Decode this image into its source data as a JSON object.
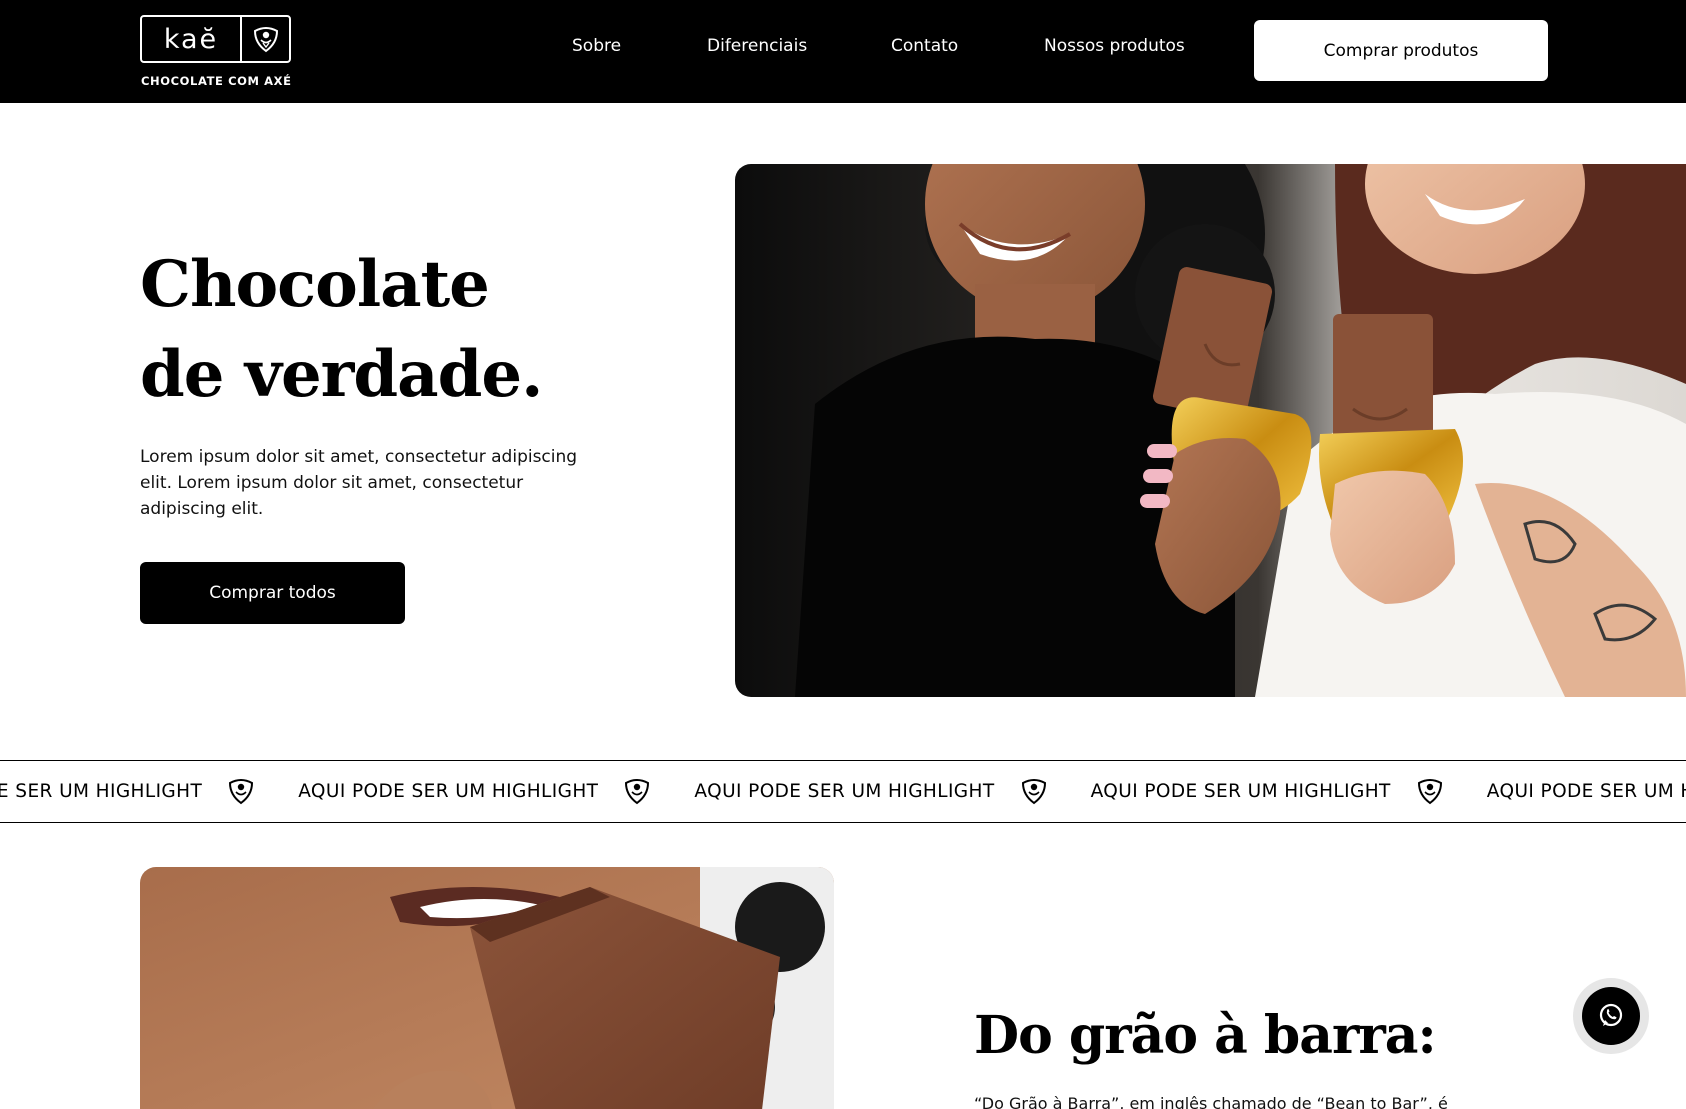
{
  "header": {
    "logo_text": "kaĕ",
    "logo_tagline": "CHOCOLATE COM AXÉ",
    "nav": [
      {
        "label": "Sobre"
      },
      {
        "label": "Diferenciais"
      },
      {
        "label": "Contato"
      },
      {
        "label": "Nossos produtos"
      }
    ],
    "cta_label": "Comprar produtos"
  },
  "hero": {
    "title_line1": "Chocolate",
    "title_line2": "de verdade.",
    "description": "Lorem ipsum dolor sit amet, consectetur adipiscing elit. Lorem ipsum dolor sit amet, consectetur adipiscing elit.",
    "button_label": "Comprar todos"
  },
  "marquee": {
    "items": [
      "AQUI PODE SER UM HIGHLIGHT",
      "AQUI PODE SER UM HIGHLIGHT",
      "AQUI PODE SER UM HIGHLIGHT",
      "AQUI PODE SER UM HIGHLIGHT",
      "AQUI PODE SER UM HIGHLIGHT"
    ],
    "icon": "brand-mark-icon"
  },
  "section2": {
    "title": "Do grão à barra:",
    "text": "“Do Grão à Barra”, em inglês chamado de “Bean to Bar”, é"
  },
  "floating": {
    "whatsapp_icon": "whatsapp-icon"
  },
  "colors": {
    "primary": "#000000",
    "background": "#ffffff",
    "chocolate": "#8a5238",
    "gold_foil": "#d9a21e"
  }
}
